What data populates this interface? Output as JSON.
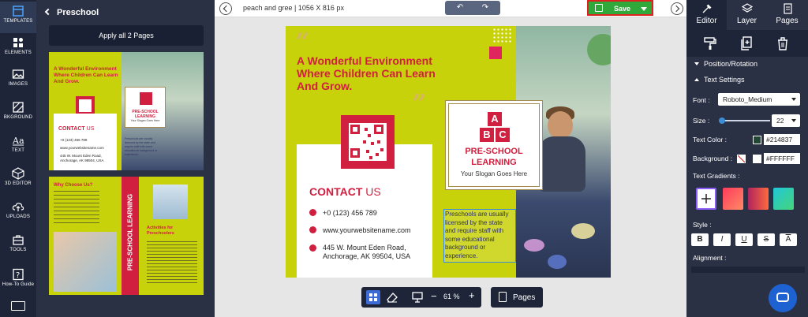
{
  "rail": {
    "items": [
      {
        "label": "TEMPLATES",
        "icon": "templates-icon"
      },
      {
        "label": "ELEMENTS",
        "icon": "elements-icon"
      },
      {
        "label": "IMAGES",
        "icon": "images-icon"
      },
      {
        "label": "BKGROUND",
        "icon": "background-icon"
      },
      {
        "label": "TEXT",
        "icon": "text-icon"
      },
      {
        "label": "3D EDITOR",
        "icon": "3d-editor-icon"
      },
      {
        "label": "UPLOADS",
        "icon": "uploads-icon"
      },
      {
        "label": "TOOLS",
        "icon": "tools-icon"
      },
      {
        "label": "How-To Guide",
        "icon": "guide-icon"
      }
    ]
  },
  "panel": {
    "title": "Preschool",
    "apply_label": "Apply all 2 Pages",
    "thumb1": {
      "headline": "A Wonderful Environment Where Children Can Learn And Grow.",
      "contact": "CONTACT",
      "contact_us": "US",
      "phone": "+0 (123) 456 789",
      "web": "www.yourwebsitename.com",
      "address": "445 W. Mount Eden Road, Anchorage, AK 99504, USA",
      "brand": "PRE-SCHOOL LEARNING",
      "slogan": "Your Slogan Goes Here",
      "note": "Preschools are usually licensed by the state and require staff with some educational background or experience."
    },
    "thumb2": {
      "why": "Why Choose Us?",
      "vertical": "PRE-SCHOOL LEARNING",
      "activities": "Activities for Preschoolers"
    }
  },
  "topbar": {
    "doc_title": "peach and gree | 1056 X 816 px",
    "save_label": "Save"
  },
  "design": {
    "headline": "A Wonderful Environment Where Children Can Learn And Grow.",
    "brand_letters": [
      "A",
      "B",
      "C"
    ],
    "brand_title_1": "PRE-SCHOOL",
    "brand_title_2": "LEARNING",
    "slogan": "Your Slogan Goes Here",
    "contact_word": "CONTACT",
    "contact_us": "US",
    "phone": "+0 (123) 456 789",
    "web": "www.yourwebsitename.com",
    "address_1": "445 W. Mount Eden Road,",
    "address_2": "Anchorage, AK 99504, USA",
    "note": "Preschools are usually licensed by the state and require staff with some educational background or experience."
  },
  "bottom": {
    "zoom": "61 %",
    "pages_label": "Pages"
  },
  "rpanel": {
    "tabs": [
      {
        "label": "Editor",
        "icon": "editor-icon"
      },
      {
        "label": "Layer",
        "icon": "layer-icon"
      },
      {
        "label": "Pages",
        "icon": "pages-icon"
      }
    ],
    "position_rotation": "Position/Rotation",
    "text_settings": "Text Settings",
    "font_label": "Font :",
    "font_value": "Roboto_Medium",
    "size_label": "Size :",
    "size_value": "22",
    "text_color_label": "Text Color :",
    "text_color_hex": "#214837",
    "bg_label": "Background :",
    "bg_hex": "#FFFFFF",
    "gradients_label": "Text Gradients :",
    "style_label": "Style :",
    "style_buttons": [
      "B",
      "I",
      "U",
      "S",
      "A"
    ],
    "alignment_label": "Alignment :"
  },
  "colors": {
    "brand_red": "#d01f3f",
    "lime": "#c8d20a",
    "save_green": "#30a93a",
    "text_color": "#214837"
  }
}
